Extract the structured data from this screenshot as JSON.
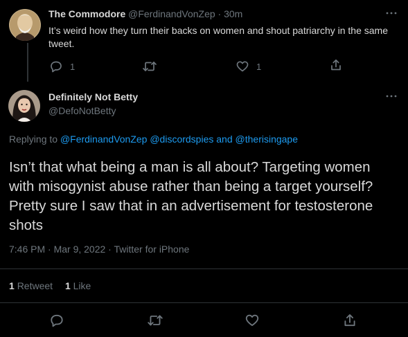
{
  "parent_tweet": {
    "author_name": "The Commodore",
    "handle": "@FerdinandVonZep",
    "separator": "·",
    "time_ago": "30m",
    "text": "It’s weird how they turn their backs on women and shout patriarchy in the same tweet.",
    "reply_count": "1",
    "retweet_count": "",
    "like_count": "1"
  },
  "main_tweet": {
    "author_name": "Definitely Not Betty",
    "handle": "@DefoNotBetty",
    "replying_to_label": "Replying to",
    "mention_1": "@FerdinandVonZep",
    "mention_2": "@discordspies",
    "and_word": "and",
    "mention_3": "@therisingape",
    "text": "Isn’t that what being a man is all about? Targeting women with misogynist abuse rather than being a target yourself? Pretty sure I saw that in an advertisement for testosterone shots",
    "timestamp": "7:46 PM · Mar 9, 2022 · Twitter for iPhone",
    "retweet_count": "1",
    "retweet_label": "Retweet",
    "like_count": "1",
    "like_label": "Like"
  },
  "icons": {
    "more": "more-icon",
    "reply": "reply-icon",
    "retweet": "retweet-icon",
    "like": "heart-icon",
    "share": "share-icon"
  },
  "colors": {
    "background": "#000000",
    "text": "#d9d9d9",
    "secondary": "#6e767d",
    "link": "#1d9bf0",
    "divider": "#2f3336"
  }
}
